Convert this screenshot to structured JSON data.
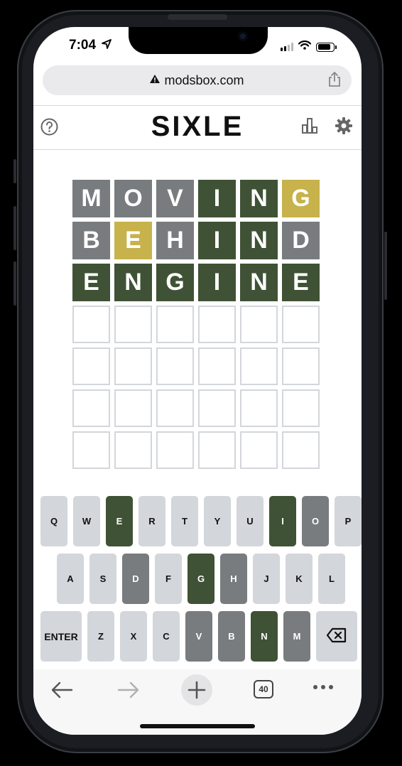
{
  "status_bar": {
    "time": "7:04"
  },
  "browser": {
    "url": "modsbox.com",
    "tab_count": "40"
  },
  "game": {
    "title": "SIXLE",
    "board": [
      [
        {
          "letter": "M",
          "state": "absent"
        },
        {
          "letter": "O",
          "state": "absent"
        },
        {
          "letter": "V",
          "state": "absent"
        },
        {
          "letter": "I",
          "state": "correct"
        },
        {
          "letter": "N",
          "state": "correct"
        },
        {
          "letter": "G",
          "state": "present"
        }
      ],
      [
        {
          "letter": "B",
          "state": "absent"
        },
        {
          "letter": "E",
          "state": "present"
        },
        {
          "letter": "H",
          "state": "absent"
        },
        {
          "letter": "I",
          "state": "correct"
        },
        {
          "letter": "N",
          "state": "correct"
        },
        {
          "letter": "D",
          "state": "absent"
        }
      ],
      [
        {
          "letter": "E",
          "state": "correct"
        },
        {
          "letter": "N",
          "state": "correct"
        },
        {
          "letter": "G",
          "state": "correct"
        },
        {
          "letter": "I",
          "state": "correct"
        },
        {
          "letter": "N",
          "state": "correct"
        },
        {
          "letter": "E",
          "state": "correct"
        }
      ],
      [
        {
          "letter": "",
          "state": "empty"
        },
        {
          "letter": "",
          "state": "empty"
        },
        {
          "letter": "",
          "state": "empty"
        },
        {
          "letter": "",
          "state": "empty"
        },
        {
          "letter": "",
          "state": "empty"
        },
        {
          "letter": "",
          "state": "empty"
        }
      ],
      [
        {
          "letter": "",
          "state": "empty"
        },
        {
          "letter": "",
          "state": "empty"
        },
        {
          "letter": "",
          "state": "empty"
        },
        {
          "letter": "",
          "state": "empty"
        },
        {
          "letter": "",
          "state": "empty"
        },
        {
          "letter": "",
          "state": "empty"
        }
      ],
      [
        {
          "letter": "",
          "state": "empty"
        },
        {
          "letter": "",
          "state": "empty"
        },
        {
          "letter": "",
          "state": "empty"
        },
        {
          "letter": "",
          "state": "empty"
        },
        {
          "letter": "",
          "state": "empty"
        },
        {
          "letter": "",
          "state": "empty"
        }
      ],
      [
        {
          "letter": "",
          "state": "empty"
        },
        {
          "letter": "",
          "state": "empty"
        },
        {
          "letter": "",
          "state": "empty"
        },
        {
          "letter": "",
          "state": "empty"
        },
        {
          "letter": "",
          "state": "empty"
        },
        {
          "letter": "",
          "state": "empty"
        }
      ]
    ]
  },
  "keyboard": {
    "rows": [
      [
        {
          "label": "Q",
          "state": "unused"
        },
        {
          "label": "W",
          "state": "unused"
        },
        {
          "label": "E",
          "state": "correct"
        },
        {
          "label": "R",
          "state": "unused"
        },
        {
          "label": "T",
          "state": "unused"
        },
        {
          "label": "Y",
          "state": "unused"
        },
        {
          "label": "U",
          "state": "unused"
        },
        {
          "label": "I",
          "state": "correct"
        },
        {
          "label": "O",
          "state": "absent"
        },
        {
          "label": "P",
          "state": "unused"
        }
      ],
      [
        {
          "label": "A",
          "state": "unused"
        },
        {
          "label": "S",
          "state": "unused"
        },
        {
          "label": "D",
          "state": "absent"
        },
        {
          "label": "F",
          "state": "unused"
        },
        {
          "label": "G",
          "state": "correct"
        },
        {
          "label": "H",
          "state": "absent"
        },
        {
          "label": "J",
          "state": "unused"
        },
        {
          "label": "K",
          "state": "unused"
        },
        {
          "label": "L",
          "state": "unused"
        }
      ],
      [
        {
          "label": "ENTER",
          "state": "unused",
          "wide": true
        },
        {
          "label": "Z",
          "state": "unused"
        },
        {
          "label": "X",
          "state": "unused"
        },
        {
          "label": "C",
          "state": "unused"
        },
        {
          "label": "V",
          "state": "absent"
        },
        {
          "label": "B",
          "state": "absent"
        },
        {
          "label": "N",
          "state": "correct"
        },
        {
          "label": "M",
          "state": "absent"
        },
        {
          "label": "",
          "state": "unused",
          "wide": true,
          "icon": "backspace-icon"
        }
      ]
    ]
  },
  "icons": {
    "status": [
      "location-arrow-icon",
      "signal-icon",
      "wifi-icon",
      "battery-icon"
    ],
    "header": [
      "help-icon",
      "stats-icon",
      "settings-icon"
    ],
    "url": [
      "lock-warning-icon",
      "share-icon"
    ],
    "toolbar": [
      "back-arrow-icon",
      "forward-arrow-icon",
      "new-tab-icon",
      "tabs-icon",
      "more-icon"
    ]
  },
  "colors": {
    "correct": "#3f5235",
    "present": "#c7b24b",
    "absent": "#787c7e",
    "unused_key": "#d3d6da"
  }
}
